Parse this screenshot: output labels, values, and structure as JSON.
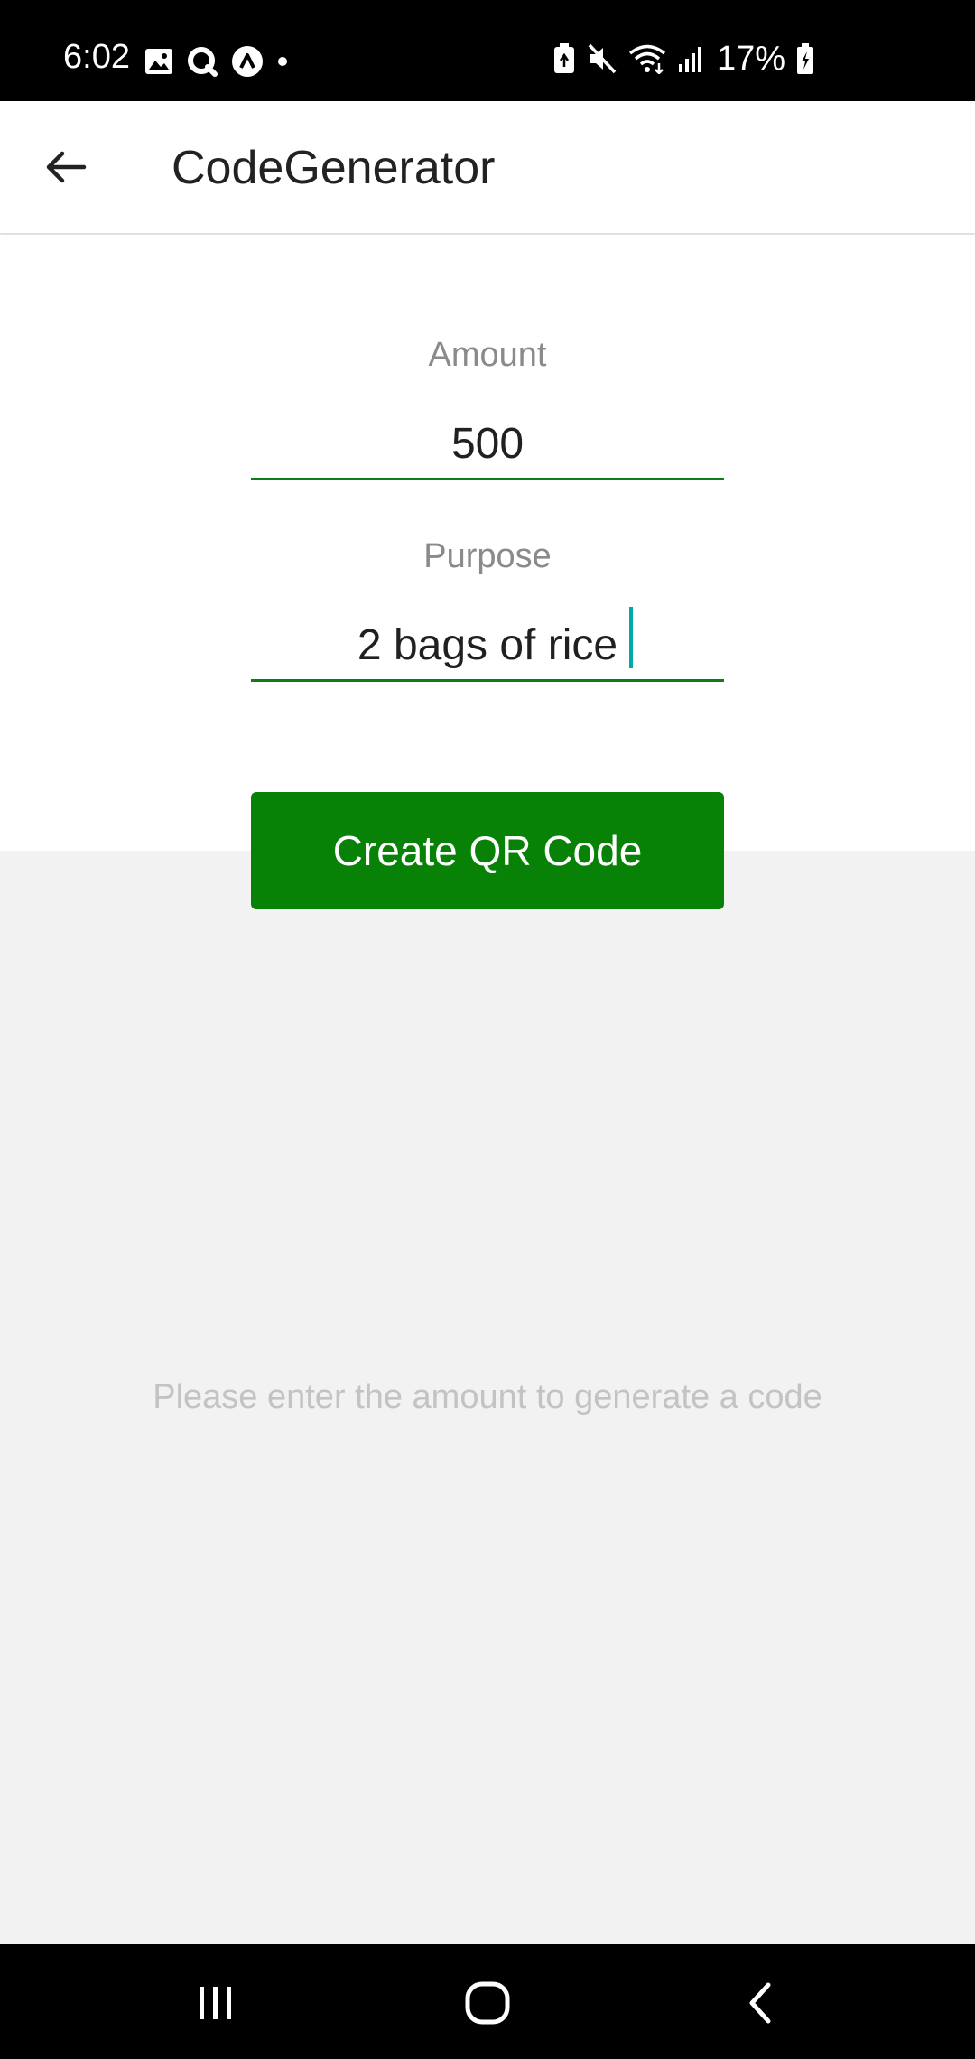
{
  "status_bar": {
    "time": "6:02",
    "battery": "17%",
    "left_icons": [
      "image-icon",
      "q-app-icon",
      "caret-app-icon",
      "dot-icon"
    ],
    "right_icons": [
      "battery-saver-icon",
      "mute-icon",
      "wifi-icon",
      "signal-icon",
      "battery-charging-icon"
    ]
  },
  "app_bar": {
    "title": "CodeGenerator",
    "back_icon": "arrow-left-icon"
  },
  "form": {
    "amount_label": "Amount",
    "amount_value": "500",
    "purpose_label": "Purpose",
    "purpose_value": "2 bags of rice",
    "submit_label": "Create QR Code"
  },
  "result": {
    "hint": "Please enter the amount to generate a code"
  },
  "colors": {
    "accent": "#078207",
    "caret": "#00a8a8",
    "hint": "#c3c3c3",
    "label": "#8a8a8a",
    "background": "#f2f2f2"
  },
  "nav_bar": {
    "icons": [
      "recent-apps-icon",
      "home-icon",
      "back-icon"
    ]
  }
}
